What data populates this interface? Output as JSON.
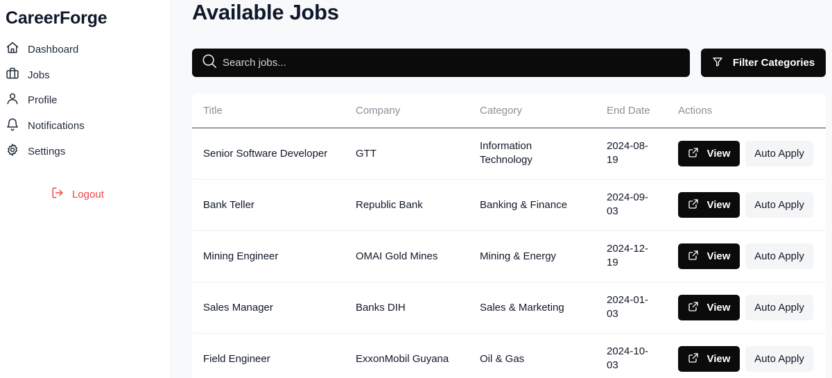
{
  "app": {
    "brand": "CareerForge"
  },
  "sidebar": {
    "items": [
      {
        "label": "Dashboard",
        "icon": "home-icon"
      },
      {
        "label": "Jobs",
        "icon": "briefcase-icon"
      },
      {
        "label": "Profile",
        "icon": "user-icon"
      },
      {
        "label": "Notifications",
        "icon": "bell-icon"
      },
      {
        "label": "Settings",
        "icon": "gear-icon"
      }
    ],
    "logout_label": "Logout"
  },
  "main": {
    "title": "Available Jobs",
    "search": {
      "placeholder": "Search jobs...",
      "value": ""
    },
    "filter_label": "Filter Categories",
    "table": {
      "columns": [
        "Title",
        "Company",
        "Category",
        "End Date",
        "Actions"
      ],
      "view_label": "View",
      "auto_apply_label": "Auto Apply",
      "rows": [
        {
          "title": "Senior Software Developer",
          "company": "GTT",
          "category": [
            "Information",
            "Technology"
          ],
          "end_date": [
            "2024-08-",
            "19"
          ]
        },
        {
          "title": "Bank Teller",
          "company": "Republic Bank",
          "category": [
            "Banking & Finance"
          ],
          "end_date": [
            "2024-09-",
            "03"
          ]
        },
        {
          "title": "Mining Engineer",
          "company": "OMAI Gold Mines",
          "category": [
            "Mining & Energy"
          ],
          "end_date": [
            "2024-12-",
            "19"
          ]
        },
        {
          "title": "Sales Manager",
          "company": "Banks DIH",
          "category": [
            "Sales & Marketing"
          ],
          "end_date": [
            "2024-01-",
            "03"
          ]
        },
        {
          "title": "Field Engineer",
          "company": "ExxonMobil Guyana",
          "category": [
            "Oil & Gas"
          ],
          "end_date": [
            "2024-10-",
            "03"
          ]
        }
      ]
    }
  },
  "colors": {
    "accent": "#0b0b0b",
    "danger": "#ef4444",
    "background": "#f8f9fb"
  }
}
